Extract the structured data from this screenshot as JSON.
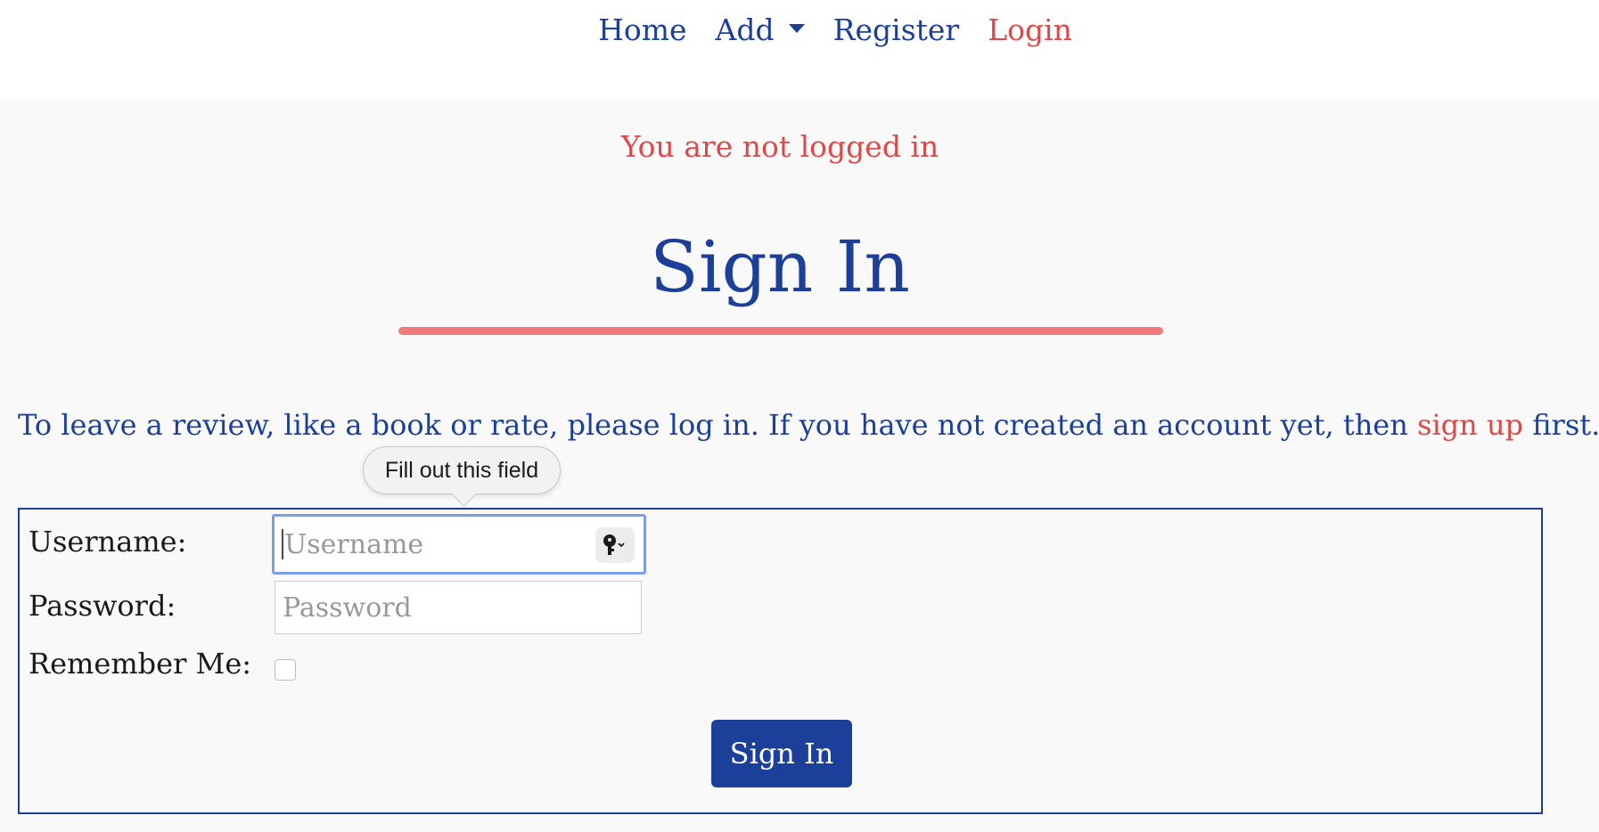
{
  "nav": {
    "items": [
      {
        "label": "Home"
      },
      {
        "label": "Add"
      },
      {
        "label": "Register"
      },
      {
        "label": "Login"
      }
    ],
    "active_color": "#e04848",
    "link_color": "#1c3f9a"
  },
  "status_message": "You are not logged in",
  "page_title": "Sign In",
  "intro": {
    "before": "To leave a review, like a book or rate, please log in. If you have not created an account yet, then ",
    "link": "sign up",
    "after": " first."
  },
  "form": {
    "username_label": "Username:",
    "username_placeholder": "Username",
    "password_label": "Password:",
    "password_placeholder": "Password",
    "remember_label": "Remember Me:",
    "remember_checked": false,
    "submit_label": "Sign In",
    "password_manager_icon": "key-icon"
  },
  "tooltip": {
    "text": "Fill out this field"
  }
}
